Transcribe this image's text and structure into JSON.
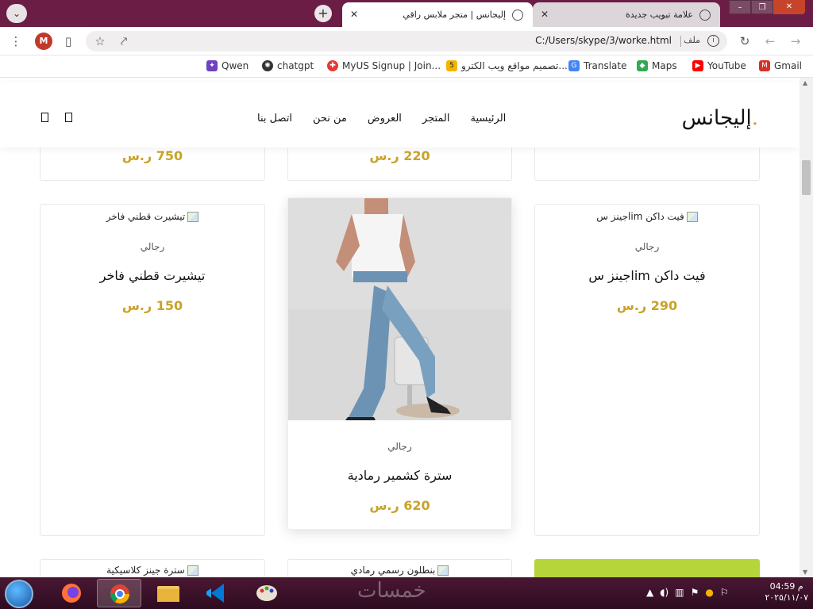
{
  "browser": {
    "tabs": [
      {
        "label": "علامة تبويب جديدة",
        "active": false
      },
      {
        "label": "إليجانس | متجر ملابس راقي",
        "active": true
      }
    ],
    "url": "C:/Users/skype/3/worke.html",
    "url_scheme_label": "ملف",
    "profile_initial": "M",
    "bookmarks": [
      {
        "label": "Gmail",
        "icon": "gmail-icon",
        "color": "#d93025"
      },
      {
        "label": "YouTube",
        "icon": "youtube-icon",
        "color": "#ff0000"
      },
      {
        "label": "Maps",
        "icon": "maps-icon",
        "color": "#34a853"
      },
      {
        "label": "Translate",
        "icon": "translate-icon",
        "color": "#4285f4"
      },
      {
        "label": "تصميم مواقع ويب الكترو...",
        "icon": "five-icon",
        "color": "#f4b400"
      },
      {
        "label": "MyUS Signup | Join...",
        "icon": "myus-icon",
        "color": "#e53935"
      },
      {
        "label": "chatgpt",
        "icon": "chatgpt-icon",
        "color": "#333333"
      },
      {
        "label": "Qwen",
        "icon": "qwen-icon",
        "color": "#6f42c1"
      }
    ]
  },
  "site": {
    "logo_text": "إليجانس",
    "logo_dot": ".",
    "nav": [
      "الرئيسية",
      "المتجر",
      "العروض",
      "من نحن",
      "اتصل بنا"
    ],
    "accent_color": "#c9a227"
  },
  "top_prices": [
    "750 ر.س",
    "220 ر.س"
  ],
  "products": [
    {
      "img_alt": "جينز سlim فيت داكن",
      "category": "رجالي",
      "title": "جينز سlim فيت داكن",
      "price": "290 ر.س"
    },
    {
      "img_alt": "",
      "category": "رجالي",
      "title": "سترة كشمير رمادية",
      "price": "620 ر.س"
    },
    {
      "img_alt": "تيشيرت قطني فاخر",
      "category": "رجالي",
      "title": "تيشيرت قطني فاخر",
      "price": "150 ر.س"
    }
  ],
  "bottom_row": [
    {
      "img_alt": "بنطلون رسمي رمادي"
    },
    {
      "img_alt": "سترة جينز كلاسيكية"
    }
  ],
  "taskbar": {
    "time": "04:59 م",
    "date": "٢٠٢٥/١١/٠٧",
    "watermark": "خمسات"
  }
}
